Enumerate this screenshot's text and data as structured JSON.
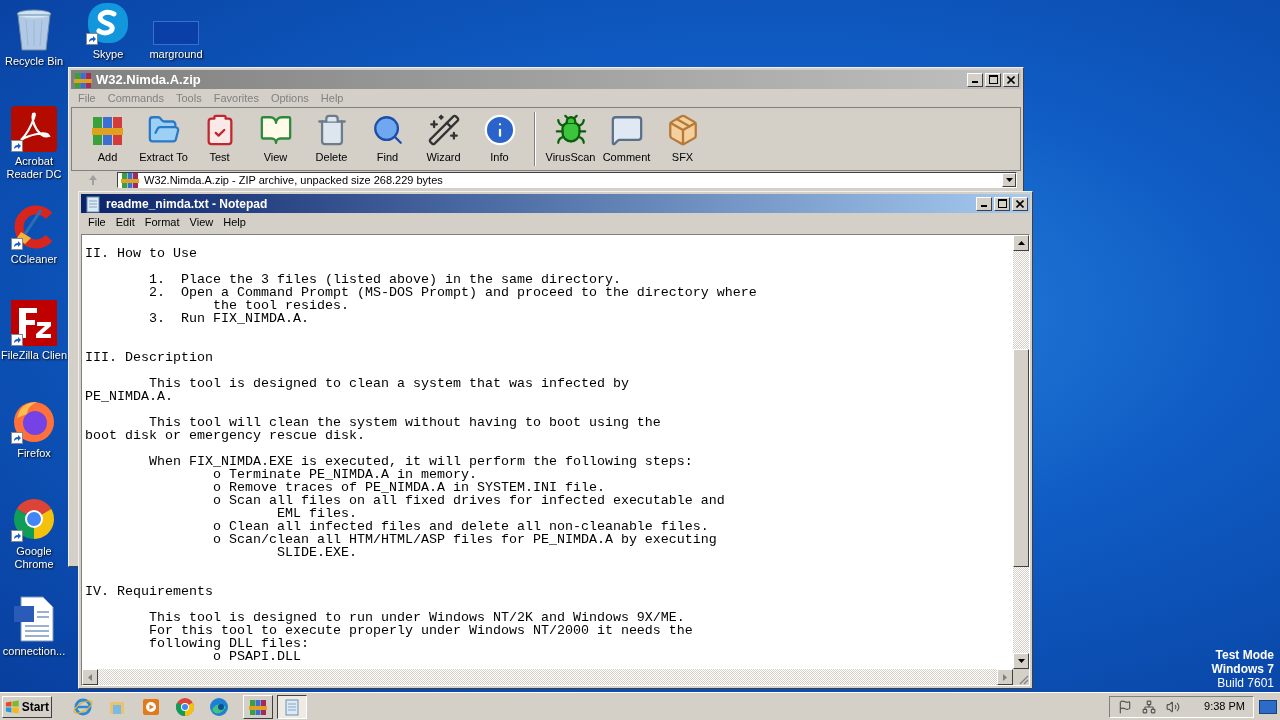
{
  "desktop_icons": [
    {
      "label": "Recycle Bin",
      "kind": "recycle",
      "shortcut": false
    },
    {
      "label": "Skype",
      "kind": "skype",
      "shortcut": true
    },
    {
      "label": "marground",
      "kind": "thumbnail",
      "shortcut": false
    },
    {
      "label": "Acrobat Reader DC",
      "kind": "acrobat",
      "shortcut": true
    },
    {
      "label": "CCleaner",
      "kind": "ccleaner",
      "shortcut": true
    },
    {
      "label": "FileZilla Clien",
      "kind": "filezilla",
      "shortcut": true
    },
    {
      "label": "Firefox",
      "kind": "firefox",
      "shortcut": true
    },
    {
      "label": "Google Chrome",
      "kind": "chrome",
      "shortcut": true
    },
    {
      "label": "connection...",
      "kind": "document",
      "shortcut": false
    }
  ],
  "archive_window": {
    "title": "W32.Nimda.A.zip",
    "active": false,
    "menu": [
      "File",
      "Commands",
      "Tools",
      "Favorites",
      "Options",
      "Help"
    ],
    "toolbar": [
      {
        "label": "Add",
        "kind": "add"
      },
      {
        "label": "Extract To",
        "kind": "extract"
      },
      {
        "label": "Test",
        "kind": "test"
      },
      {
        "label": "View",
        "kind": "view"
      },
      {
        "label": "Delete",
        "kind": "delete"
      },
      {
        "label": "Find",
        "kind": "find"
      },
      {
        "label": "Wizard",
        "kind": "wizard"
      },
      {
        "label": "Info",
        "kind": "info"
      },
      {
        "kind": "separator"
      },
      {
        "label": "VirusScan",
        "kind": "virusscan"
      },
      {
        "label": "Comment",
        "kind": "comment"
      },
      {
        "label": "SFX",
        "kind": "sfx"
      }
    ],
    "path": "W32.Nimda.A.zip - ZIP archive, unpacked size 268.229 bytes"
  },
  "notepad_window": {
    "title": "readme_nimda.txt - Notepad",
    "active": true,
    "menu": [
      "File",
      "Edit",
      "Format",
      "View",
      "Help"
    ],
    "text": "II. How to Use\n\n        1.  Place the 3 files (listed above) in the same directory.\n        2.  Open a Command Prompt (MS-DOS Prompt) and proceed to the directory where\n                the tool resides.\n        3.  Run FIX_NIMDA.A.\n\n\nIII. Description\n\n        This tool is designed to clean a system that was infected by\nPE_NIMDA.A.\n\n        This tool will clean the system without having to boot using the\nboot disk or emergency rescue disk.\n\n        When FIX_NIMDA.EXE is executed, it will perform the following steps:\n                o Terminate PE_NIMDA.A in memory.\n                o Remove traces of PE_NIMDA.A in SYSTEM.INI file.\n                o Scan all files on all fixed drives for infected executable and\n                        EML files.\n                o Clean all infected files and delete all non-cleanable files.\n                o Scan/clean all HTM/HTML/ASP files for PE_NIMDA.A by executing\n                        SLIDE.EXE.\n\n\nIV. Requirements\n\n        This tool is designed to run under Windows NT/2K and Windows 9X/ME.\n        For this tool to execute properly under Windows NT/2000 it needs the\n        following DLL files:\n                o PSAPI.DLL"
  },
  "system_info": [
    {
      "text": "Test Mode",
      "bold": true
    },
    {
      "text": "Windows 7",
      "bold": true
    },
    {
      "text": "Build 7601",
      "bold": false
    }
  ],
  "taskbar": {
    "start": "Start",
    "quick_launch": [
      {
        "kind": "ie"
      },
      {
        "kind": "explorer"
      },
      {
        "kind": "media"
      },
      {
        "kind": "chrome"
      },
      {
        "kind": "edge"
      }
    ],
    "windows": [
      {
        "kind": "winrar",
        "selected": false
      },
      {
        "kind": "notepad",
        "selected": true
      }
    ],
    "clock": "9:38 PM"
  }
}
